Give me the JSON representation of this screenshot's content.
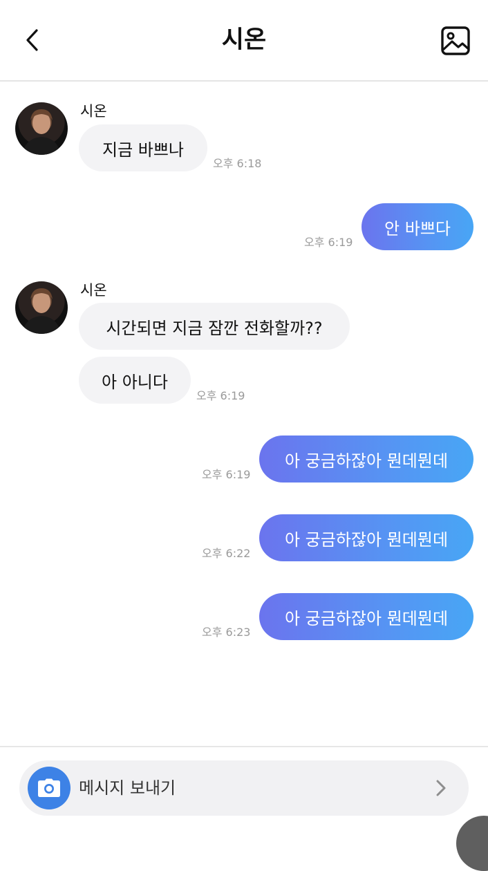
{
  "header": {
    "title": "시온",
    "back_icon": "chevron-left-icon",
    "gallery_icon": "image-icon"
  },
  "messages": [
    {
      "type": "incoming",
      "sender": "시온",
      "text": "지금 바쁘나",
      "time": "오후 6:18"
    },
    {
      "type": "outgoing",
      "text": "안 바쁘다",
      "time": "오후 6:19"
    },
    {
      "type": "incoming",
      "sender": "시온",
      "text": "시간되면 지금 잠깐 전화할까??",
      "time": ""
    },
    {
      "type": "incoming",
      "text": "아 아니다",
      "time": "오후 6:19"
    },
    {
      "type": "outgoing",
      "text": "아 궁금하잖아 뭔데뭔데",
      "time": "오후 6:19"
    },
    {
      "type": "outgoing",
      "text": "아 궁금하잖아 뭔데뭔데",
      "time": "오후 6:22"
    },
    {
      "type": "outgoing",
      "text": "아 궁금하잖아 뭔데뭔데",
      "time": "오후 6:23"
    }
  ],
  "composer": {
    "placeholder": "메시지 보내기",
    "camera_icon": "camera-icon",
    "send_icon": "chevron-right-icon"
  },
  "colors": {
    "outgoing_start": "#6b74ee",
    "outgoing_end": "#48a6f5",
    "incoming_bg": "#f3f3f5",
    "camera_button": "#3d82e6",
    "timestamp": "#9a9a9a"
  }
}
